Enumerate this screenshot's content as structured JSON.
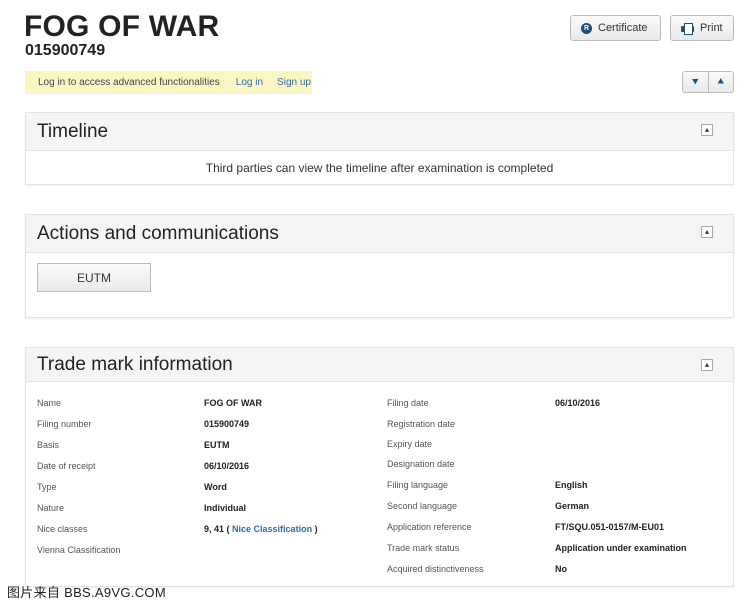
{
  "header": {
    "title": "FOG OF WAR",
    "number": "015900749",
    "certificate_label": "Certificate",
    "print_label": "Print"
  },
  "login_bar": {
    "text": "Log in to access advanced functionalities",
    "login_link": "Log in",
    "signup_link": "Sign up"
  },
  "timeline": {
    "title": "Timeline",
    "message": "Third parties can view the timeline after examination is completed"
  },
  "actions": {
    "title": "Actions and communications",
    "button_label": "EUTM"
  },
  "trademark": {
    "title": "Trade mark information",
    "left": [
      {
        "label": "Name",
        "value": "FOG OF WAR"
      },
      {
        "label": "Filing number",
        "value": "015900749"
      },
      {
        "label": "Basis",
        "value": "EUTM"
      },
      {
        "label": "Date of receipt",
        "value": "06/10/2016"
      },
      {
        "label": "Type",
        "value": "Word"
      },
      {
        "label": "Nature",
        "value": "Individual"
      },
      {
        "label": "Nice classes",
        "value": "9, 41 (",
        "link": "Nice Classification",
        "suffix": ")"
      },
      {
        "label": "Vienna Classification",
        "value": ""
      }
    ],
    "right": [
      {
        "label": "Filing date",
        "value": "06/10/2016"
      },
      {
        "label": "Registration date",
        "value": ""
      },
      {
        "label": "Expiry date",
        "value": ""
      },
      {
        "label": "Designation date",
        "value": ""
      },
      {
        "label": "Filing language",
        "value": "English"
      },
      {
        "label": "Second language",
        "value": "German"
      },
      {
        "label": "Application reference",
        "value": "FT/SQU.051-0157/M-EU01"
      },
      {
        "label": "Trade mark status",
        "value": "Application under examination"
      },
      {
        "label": "Acquired distinctiveness",
        "value": "No"
      }
    ]
  },
  "watermark": "图片来自 BBS.A9VG.COM",
  "icons": {
    "certificate": "certificate-icon",
    "print": "printer-icon",
    "expand_all": "expand-all-icon",
    "collapse_all": "collapse-all-icon",
    "collapse_panel": "collapse-panel-icon"
  }
}
